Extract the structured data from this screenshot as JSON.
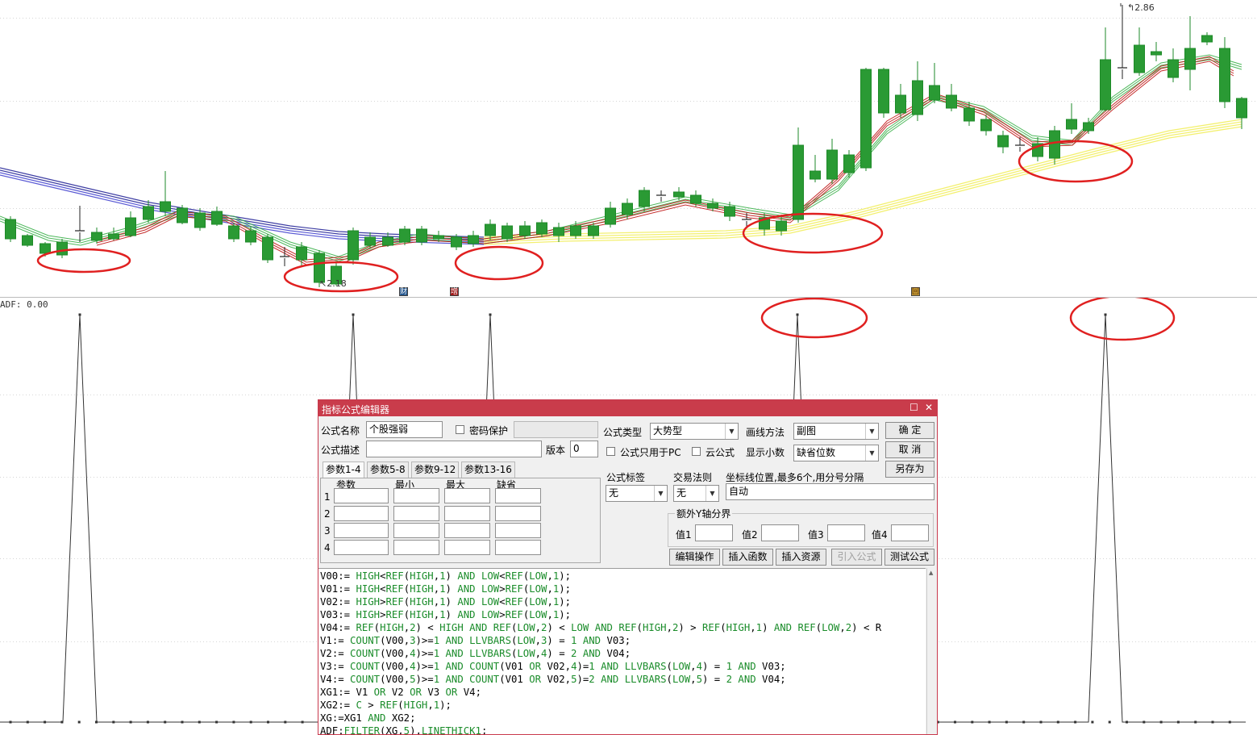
{
  "chart": {
    "price_high_label": "2.86",
    "price_low_label": "2.18",
    "sub_label": "ADF: 0.00",
    "markers": [
      "财",
      "增",
      "回"
    ]
  },
  "dialog": {
    "title": "指标公式编辑器",
    "name_label": "公式名称",
    "name_value": "个股强弱",
    "password_label": "密码保护",
    "desc_label": "公式描述",
    "desc_value": "",
    "version_label": "版本",
    "version_value": "0",
    "type_label": "公式类型",
    "type_value": "大势型",
    "draw_label": "画线方法",
    "draw_value": "副图",
    "pc_only_label": "公式只用于PC",
    "cloud_label": "云公式",
    "decimals_label": "显示小数",
    "decimals_value": "缺省位数",
    "ok": "确  定",
    "cancel": "取  消",
    "save_as": "另存为",
    "tabs": [
      "参数1-4",
      "参数5-8",
      "参数9-12",
      "参数13-16"
    ],
    "param_headers": [
      "参数",
      "最小",
      "最大",
      "缺省"
    ],
    "param_rows": [
      "1",
      "2",
      "3",
      "4"
    ],
    "tag_label": "公式标签",
    "tag_value": "无",
    "trade_label": "交易法则",
    "trade_value": "无",
    "axis_label": "坐标线位置,最多6个,用分号分隔",
    "axis_value": "自动",
    "extra_y_label": "额外Y轴分界",
    "values": [
      "值1",
      "值2",
      "值3",
      "值4"
    ],
    "buttons": [
      "编辑操作",
      "插入函数",
      "插入资源",
      "引入公式",
      "测试公式"
    ]
  },
  "code": [
    "V00:= HIGH<REF(HIGH,1) AND LOW<REF(LOW,1);",
    "V01:= HIGH<REF(HIGH,1) AND LOW>REF(LOW,1);",
    "V02:= HIGH>REF(HIGH,1) AND LOW<REF(LOW,1);",
    "V03:= HIGH>REF(HIGH,1) AND LOW>REF(LOW,1);",
    "V04:= REF(HIGH,2) < HIGH AND REF(LOW,2) < LOW AND REF(HIGH,2) > REF(HIGH,1) AND REF(LOW,2) < R",
    "V1:= COUNT(V00,3)>=1 AND LLVBARS(LOW,3) = 1 AND V03;",
    "V2:= COUNT(V00,4)>=1 AND LLVBARS(LOW,4) = 2 AND V04;",
    "V3:= COUNT(V00,4)>=1 AND COUNT(V01 OR V02,4)=1 AND LLVBARS(LOW,4) = 1 AND V03;",
    "V4:= COUNT(V00,5)>=1 AND COUNT(V01 OR V02,5)=2 AND LLVBARS(LOW,5) = 2 AND V04;",
    "XG1:= V1 OR V2 OR V3 OR V4;",
    "XG2:= C > REF(HIGH,1);",
    "XG:=XG1 AND XG2;",
    "ADF:FILTER(XG,5),LINETHICK1;"
  ]
}
